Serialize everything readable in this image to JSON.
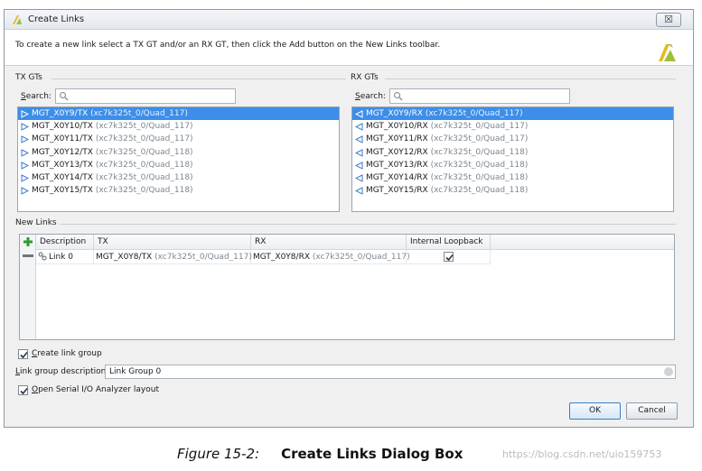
{
  "dialog": {
    "title": "Create Links",
    "instruction": "To create a new link select a TX GT and/or an RX GT, then click the Add button on the New Links toolbar.",
    "close_glyph": "☒",
    "icons": {
      "title": "xilinx-logo-icon",
      "banner": "xilinx-logo-icon"
    }
  },
  "tx": {
    "label": "TX GTs",
    "search_label_u": "S",
    "search_label_rest": "earch:",
    "search_value": "",
    "items": [
      {
        "name": "MGT_X0Y9/TX",
        "loc": "(xc7k325t_0/Quad_117)",
        "selected": true
      },
      {
        "name": "MGT_X0Y10/TX",
        "loc": "(xc7k325t_0/Quad_117)"
      },
      {
        "name": "MGT_X0Y11/TX",
        "loc": "(xc7k325t_0/Quad_117)"
      },
      {
        "name": "MGT_X0Y12/TX",
        "loc": "(xc7k325t_0/Quad_118)"
      },
      {
        "name": "MGT_X0Y13/TX",
        "loc": "(xc7k325t_0/Quad_118)"
      },
      {
        "name": "MGT_X0Y14/TX",
        "loc": "(xc7k325t_0/Quad_118)"
      },
      {
        "name": "MGT_X0Y15/TX",
        "loc": "(xc7k325t_0/Quad_118)"
      }
    ]
  },
  "rx": {
    "label": "RX GTs",
    "search_label_u": "S",
    "search_label_rest": "earch:",
    "search_value": "",
    "items": [
      {
        "name": "MGT_X0Y9/RX",
        "loc": "(xc7k325t_0/Quad_117)",
        "selected": true
      },
      {
        "name": "MGT_X0Y10/RX",
        "loc": "(xc7k325t_0/Quad_117)"
      },
      {
        "name": "MGT_X0Y11/RX",
        "loc": "(xc7k325t_0/Quad_117)"
      },
      {
        "name": "MGT_X0Y12/RX",
        "loc": "(xc7k325t_0/Quad_118)"
      },
      {
        "name": "MGT_X0Y13/RX",
        "loc": "(xc7k325t_0/Quad_118)"
      },
      {
        "name": "MGT_X0Y14/RX",
        "loc": "(xc7k325t_0/Quad_118)"
      },
      {
        "name": "MGT_X0Y15/RX",
        "loc": "(xc7k325t_0/Quad_118)"
      }
    ]
  },
  "new_links": {
    "label": "New Links",
    "columns": [
      "Description",
      "TX",
      "RX",
      "Internal Loopback"
    ],
    "rows": [
      {
        "description": "Link 0",
        "tx_name": "MGT_X0Y8/TX",
        "tx_loc": "(xc7k325t_0/Quad_117)",
        "rx_name": "MGT_X0Y8/RX",
        "rx_loc": "(xc7k325t_0/Quad_117)",
        "loopback": true
      }
    ]
  },
  "options": {
    "create_group_u": "C",
    "create_group_rest": "reate link group",
    "create_group_checked": true,
    "group_desc_label_u": "L",
    "group_desc_label_rest": "ink group description:",
    "group_desc_value": "Link Group 0",
    "open_layout_u": "O",
    "open_layout_rest": "pen Serial I/O Analyzer layout",
    "open_layout_checked": true
  },
  "buttons": {
    "ok": "OK",
    "cancel": "Cancel"
  },
  "caption": {
    "figure": "Figure 15-2:",
    "title": "Create Links Dialog Box"
  },
  "watermark": "https://blog.csdn.net/uio159753",
  "colors": {
    "selection": "#3d8ee8",
    "accent_green": "#2e9e2e",
    "logo_yellow": "#e8b82a",
    "logo_green": "#9fbf3b"
  }
}
